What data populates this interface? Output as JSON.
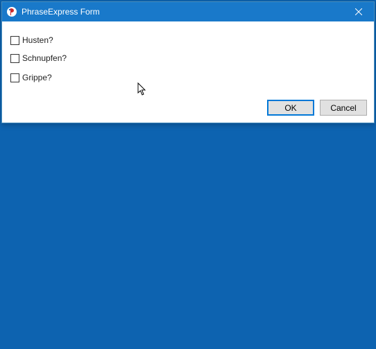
{
  "window": {
    "title": "PhraseExpress Form"
  },
  "checkboxes": [
    {
      "label": "Husten?"
    },
    {
      "label": "Schnupfen?"
    },
    {
      "label": "Grippe?"
    }
  ],
  "buttons": {
    "ok": "OK",
    "cancel": "Cancel"
  }
}
